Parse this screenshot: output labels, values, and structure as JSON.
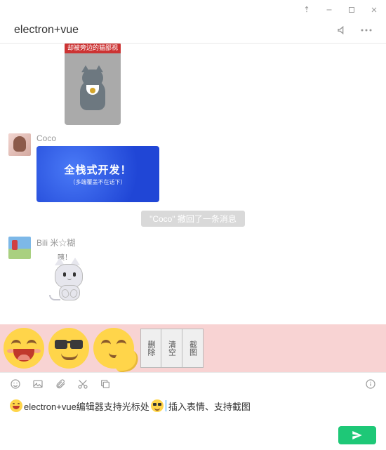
{
  "window": {
    "title": "electron+vue"
  },
  "messages": [
    {
      "sender": "",
      "image_top_caption": "却被旁边的猫鄙视了"
    },
    {
      "sender": "Coco",
      "image_text_main": "全栈式开发！",
      "image_text_sub": "（多端覆盖不在话下）"
    }
  ],
  "recall": {
    "text": "\"Coco\" 撤回了一条消息"
  },
  "sticker_msg": {
    "sender": "Bili 米☆糊",
    "sticker_caption": "咦！"
  },
  "emoji_panel": {
    "buttons": {
      "delete": "删除",
      "clear": "清空",
      "screenshot": "截图"
    }
  },
  "compose": {
    "text_before": "electron+vue编辑器支持光标处",
    "text_after": "插入表情、支持截图"
  },
  "icons": {
    "pin": "pin",
    "minimize": "minimize",
    "maximize": "maximize",
    "close": "close",
    "broadcast": "broadcast",
    "more": "more",
    "smiley": "smiley",
    "image": "image",
    "attach": "attach",
    "cut": "cut",
    "copy": "copy",
    "info": "info",
    "send": "send"
  }
}
